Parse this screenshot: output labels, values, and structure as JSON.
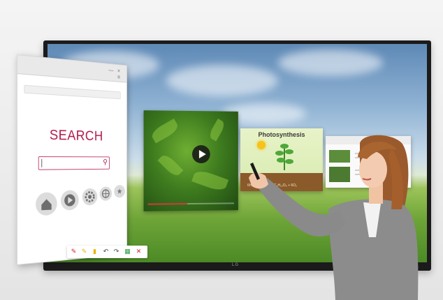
{
  "scene": {
    "description_free": true,
    "brand_mark": "LG"
  },
  "browser_panel": {
    "search_title": "SEARCH",
    "search_input_value": "",
    "window_controls": [
      "—",
      "×",
      "≡"
    ],
    "nav_icons": [
      "home-icon",
      "play-icon",
      "gear-icon",
      "globe-icon",
      "star-icon"
    ]
  },
  "video_panel": {
    "progress_fraction": 0.45
  },
  "photosynthesis_panel": {
    "title": "Photosynthesis",
    "formula": "6H₂O + 6CO₂ → C₆H₁₂O₆ + 6O₂"
  },
  "toolbar": {
    "tools": [
      "pen-icon",
      "highlighter-icon",
      "eraser-icon",
      "undo-icon",
      "redo-icon",
      "save-icon",
      "close-icon"
    ]
  },
  "colors": {
    "search_accent": "#b01a4a",
    "toolbar_pen": "#d02020",
    "toolbar_highlighter": "#e8b400",
    "toolbar_green": "#2a9a3a",
    "toolbar_red": "#d02020"
  }
}
